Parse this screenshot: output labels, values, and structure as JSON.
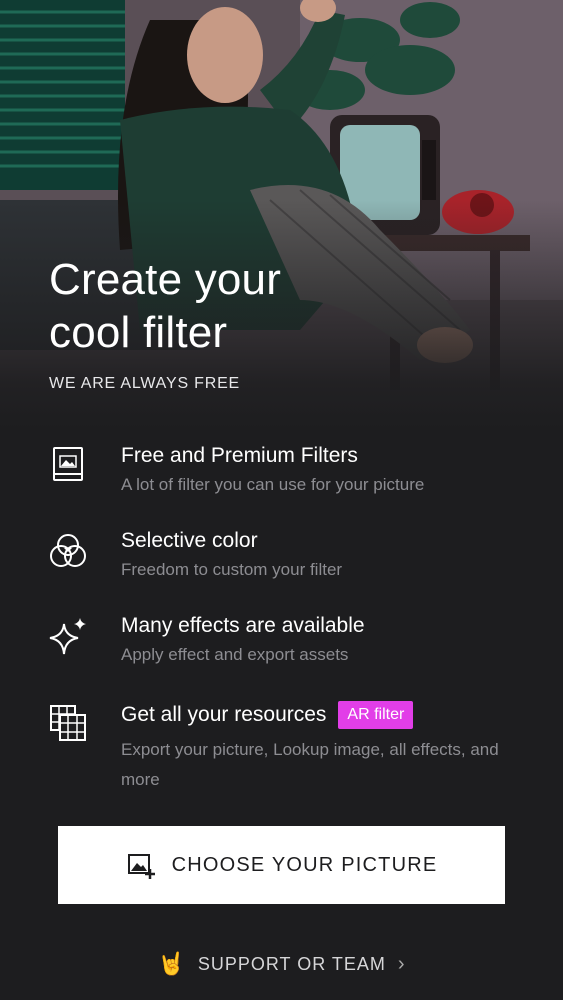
{
  "hero": {
    "title_line1": "Create your",
    "title_line2": "cool filter",
    "subtitle": "WE ARE ALWAYS FREE"
  },
  "features": [
    {
      "icon": "image-frame-icon",
      "title": "Free and Premium Filters",
      "desc": "A lot of filter you can use for your picture"
    },
    {
      "icon": "color-circles-icon",
      "title": "Selective color",
      "desc": "Freedom to custom your filter"
    },
    {
      "icon": "sparkle-icon",
      "title": "Many effects are available",
      "desc": "Apply effect and export assets"
    },
    {
      "icon": "grid-layers-icon",
      "title": "Get all your resources",
      "badge": "AR filter",
      "desc": "Export your picture, Lookup image, all effects, and more"
    }
  ],
  "cta": {
    "label": "CHOOSE YOUR PICTURE",
    "icon": "add-image-icon"
  },
  "support": {
    "label": "SUPPORT OR TEAM",
    "icon": "rock-hand-icon",
    "chevron": "chevron-right-icon"
  },
  "colors": {
    "background": "#1d1d1f",
    "badge": "#e23ee8",
    "muted_text": "#8d8d92",
    "button_bg": "#ffffff"
  }
}
